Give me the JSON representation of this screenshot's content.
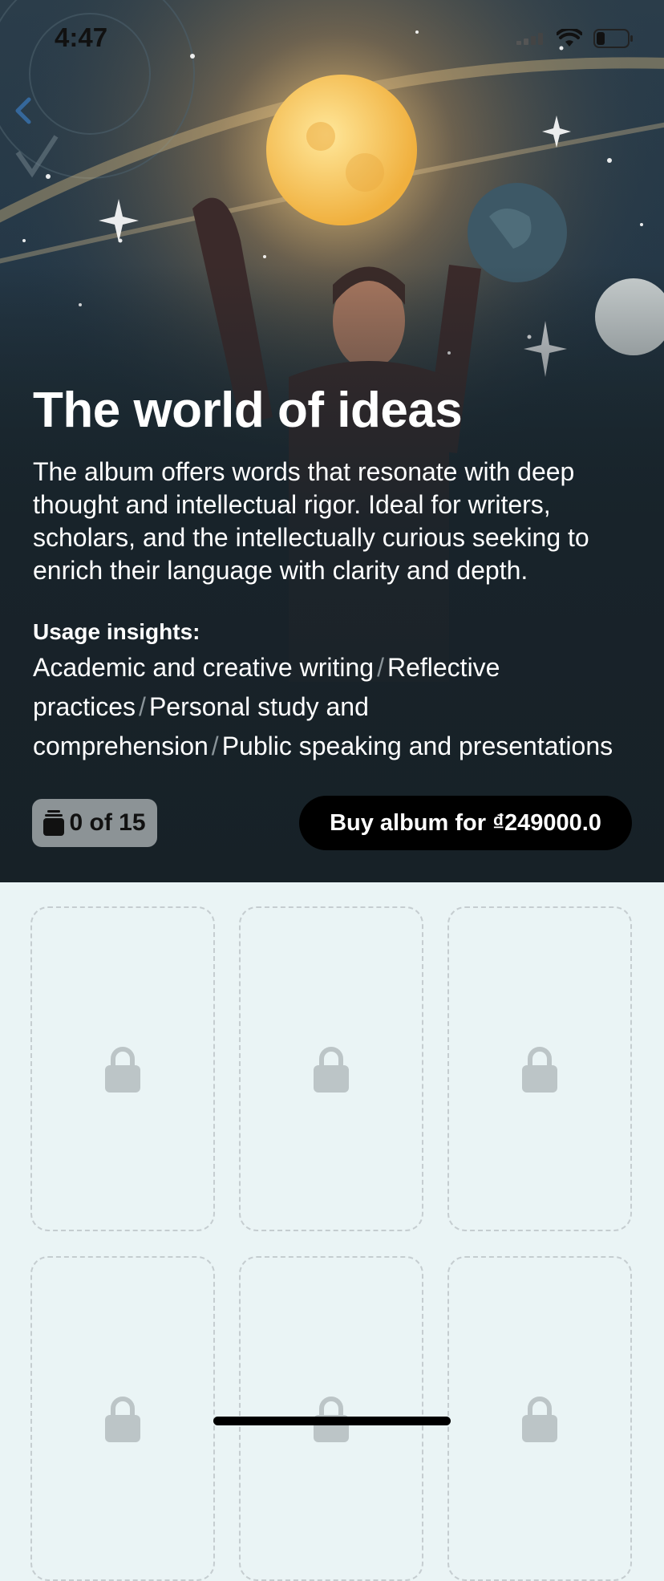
{
  "status_bar": {
    "time": "4:47"
  },
  "album": {
    "title": "The world of ideas",
    "description": "The album offers words that resonate with deep thought and intellectual rigor. Ideal for writers, scholars, and the intellectually curious seeking to enrich their language with clarity and depth.",
    "insights_label": "Usage insights:",
    "insights": [
      "Academic and creative writing",
      "Reflective practices",
      "Personal study and comprehension",
      "Public speaking and presentations"
    ],
    "separator": "/",
    "counter": "0 of 15",
    "buy_label": "Buy album for ₫249000.0"
  },
  "cards": [
    {
      "icon": "lock-icon"
    },
    {
      "icon": "lock-icon"
    },
    {
      "icon": "lock-icon"
    },
    {
      "icon": "lock-icon"
    },
    {
      "icon": "lock-icon"
    },
    {
      "icon": "lock-icon"
    }
  ],
  "colors": {
    "hero_bg": "#172127",
    "page_bg": "#eaf4f5",
    "button_bg": "#000000",
    "counter_bg": "#8c9396",
    "lock": "#bcc5c7"
  }
}
